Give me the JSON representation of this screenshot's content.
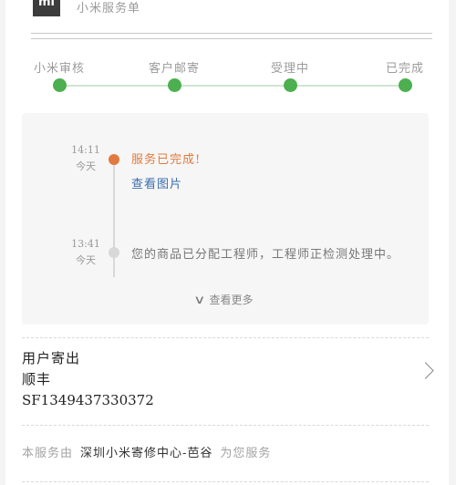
{
  "header": {
    "logo_text": "mi",
    "brand": "小米服务单"
  },
  "progress": {
    "steps": [
      {
        "label": "小米审核"
      },
      {
        "label": "客户邮寄"
      },
      {
        "label": "受理中"
      },
      {
        "label": "已完成"
      }
    ],
    "accent_color": "#4caf50"
  },
  "timeline": {
    "events": [
      {
        "time": "14:11",
        "day": "今天",
        "text": "服务已完成!",
        "link": "查看图片"
      },
      {
        "time": "13:41",
        "day": "今天",
        "text": "您的商品已分配工程师，工程师正检测处理中。"
      }
    ],
    "more_label": "查看更多",
    "highlight_color": "#e27a3f"
  },
  "shipping": {
    "title": "用户寄出",
    "carrier": "顺丰",
    "tracking_number": "SF1349437330372"
  },
  "footer": {
    "prefix": "本服务由",
    "center": "深圳小米寄修中心-芭谷",
    "suffix": "为您服务"
  }
}
